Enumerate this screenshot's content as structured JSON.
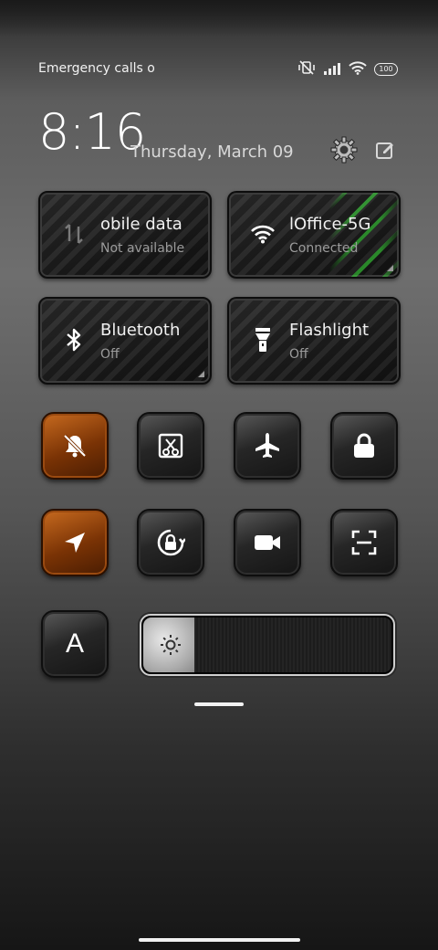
{
  "status_bar": {
    "carrier_text": "Emergency calls o",
    "battery": "100",
    "icons": [
      "vibrate-off-icon",
      "signal-icon",
      "wifi-icon",
      "battery-icon"
    ]
  },
  "header": {
    "time": "8:16",
    "date": "Thursday, March 09",
    "settings_icon": "gear-icon",
    "edit_icon": "edit-icon"
  },
  "tiles": [
    {
      "title": "obile data",
      "subtitle": "Not available",
      "icon": "mobile-data-icon"
    },
    {
      "title": "lOffice-5G",
      "subtitle": "Connected",
      "icon": "wifi-icon",
      "accent": "#3de03d"
    },
    {
      "title": "Bluetooth",
      "subtitle": "Off",
      "icon": "bluetooth-icon"
    },
    {
      "title": "Flashlight",
      "subtitle": "Off",
      "icon": "flashlight-icon"
    }
  ],
  "toggles": [
    {
      "icon": "silent-icon",
      "active": true
    },
    {
      "icon": "screenshot-icon",
      "active": false
    },
    {
      "icon": "airplane-icon",
      "active": false
    },
    {
      "icon": "lock-icon",
      "active": false
    },
    {
      "icon": "location-icon",
      "active": true
    },
    {
      "icon": "rotation-lock-icon",
      "active": false
    },
    {
      "icon": "screen-record-icon",
      "active": false
    },
    {
      "icon": "scanner-icon",
      "active": false
    }
  ],
  "auto_brightness_label": "A",
  "brightness_level": 0.2,
  "colors": {
    "active": "#b85d18",
    "connected": "#3de03d"
  }
}
